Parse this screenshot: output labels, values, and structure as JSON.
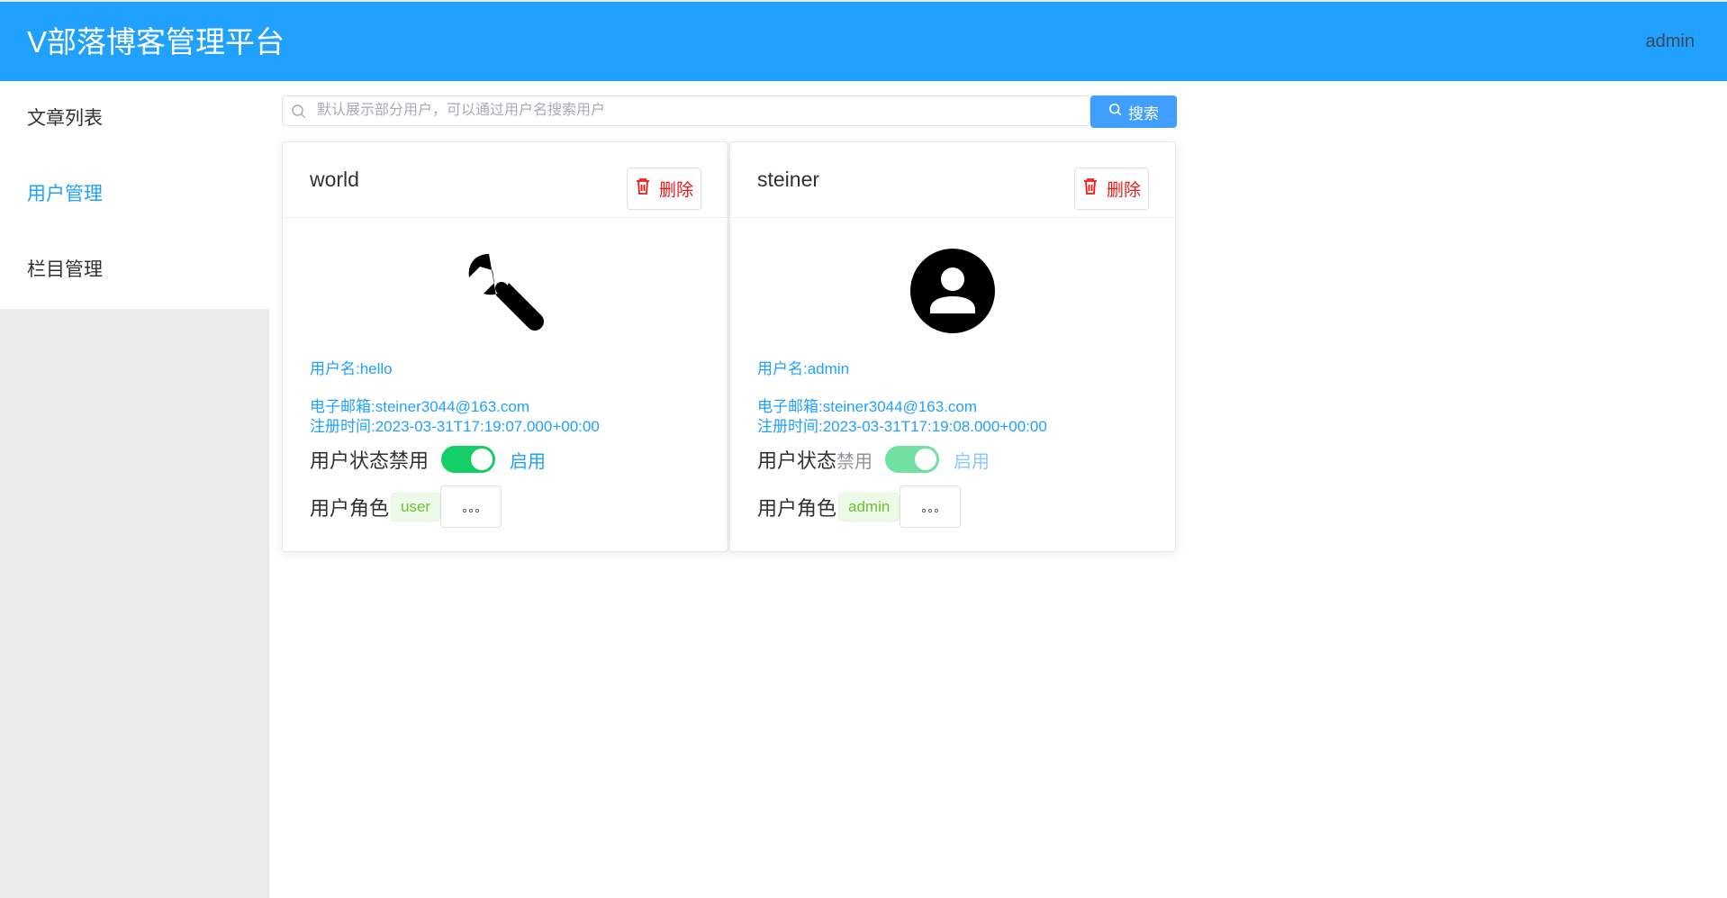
{
  "header": {
    "title": "V部落博客管理平台",
    "user": "admin"
  },
  "sidebar": {
    "items": [
      {
        "label": "文章列表",
        "active": false
      },
      {
        "label": "用户管理",
        "active": true
      },
      {
        "label": "栏目管理",
        "active": false
      }
    ]
  },
  "search": {
    "placeholder": "默认展示部分用户，可以通过用户名搜索用户",
    "value": "",
    "button_label": "搜索"
  },
  "cards": [
    {
      "name": "world",
      "delete_label": "删除",
      "avatar_icon": "wrench-icon",
      "username": "用户名:hello",
      "email": "电子邮箱:steiner3044@163.com",
      "register_time": "注册时间:2023-03-31T17:19:07.000+00:00",
      "status_label": "用户状态",
      "status_off": "禁用",
      "status_on": "启用",
      "enabled": true,
      "role_label": "用户角色",
      "role": "user",
      "more_label": "⋯"
    },
    {
      "name": "steiner",
      "delete_label": "删除",
      "avatar_icon": "user-circle-icon",
      "username": "用户名:admin",
      "email": "电子邮箱:steiner3044@163.com",
      "register_time": "注册时间:2023-03-31T17:19:08.000+00:00",
      "status_label": "用户状态",
      "status_off": "禁用",
      "status_on": "启用",
      "enabled": true,
      "role_label": "用户角色",
      "role": "admin",
      "more_label": "⋯"
    }
  ],
  "colors": {
    "primary": "#20a0ff",
    "danger": "#f01818",
    "switch_on": "#13ce66",
    "tag_green": "#67c23a"
  }
}
